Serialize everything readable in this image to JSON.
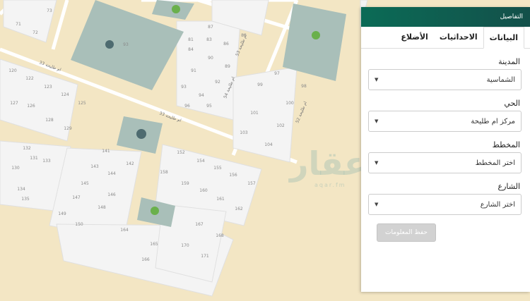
{
  "map": {
    "watermark": "عقار",
    "watermark_sub": "aqar.fm",
    "streets": [
      "ام طليحة 33",
      "ام طليحة 33",
      "ام طليحة 54",
      "ام طليحة 52",
      "ام طليحة 53"
    ],
    "lots": [
      "73",
      "71",
      "72",
      "81",
      "83",
      "84",
      "86",
      "87",
      "88",
      "89",
      "90",
      "91",
      "92",
      "93",
      "94",
      "95",
      "96",
      "97",
      "98",
      "99",
      "100",
      "101",
      "102",
      "103",
      "104",
      "120",
      "122",
      "123",
      "124",
      "125",
      "126",
      "127",
      "128",
      "129",
      "130",
      "131",
      "132",
      "133",
      "134",
      "135",
      "141",
      "142",
      "143",
      "144",
      "145",
      "146",
      "147",
      "148",
      "149",
      "150",
      "152",
      "154",
      "155",
      "156",
      "157",
      "158",
      "159",
      "160",
      "161",
      "162",
      "164",
      "165",
      "166",
      "167",
      "168",
      "170",
      "171"
    ],
    "parcel_label": "93"
  },
  "panel": {
    "header": "التفاصيل",
    "tabs": [
      "البيانات",
      "الاحداثيات",
      "الأضلاع"
    ],
    "active_tab": "البيانات",
    "fields": {
      "city_label": "المدينة",
      "city_value": "الشماسية",
      "district_label": "الحي",
      "district_value": "مركز ام طليحة",
      "plan_label": "المخطط",
      "plan_value": "اختر المخطط",
      "street_label": "الشارع",
      "street_value": "اختر الشارع"
    },
    "save_label": "حفظ المعلومات",
    "caret_icon": "caret-down-icon"
  },
  "colors": {
    "accent": "#0b6b56",
    "map_background": "#f3e6c4",
    "block_fill": "#f4f4f4",
    "park_fill": "#a9bfb9",
    "park_icon": "#6ab04c"
  }
}
